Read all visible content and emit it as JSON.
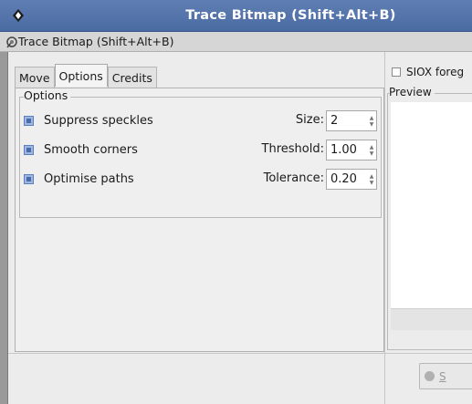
{
  "window": {
    "title": "Trace Bitmap (Shift+Alt+B)"
  },
  "dock": {
    "tab_title": "Trace Bitmap (Shift+Alt+B)"
  },
  "tabs": [
    {
      "label": "Move"
    },
    {
      "label": "Options"
    },
    {
      "label": "Credits"
    }
  ],
  "options": {
    "frame_label": "Options",
    "rows": [
      {
        "label": "Suppress speckles",
        "field_label": "Size:",
        "value": "2"
      },
      {
        "label": "Smooth corners",
        "field_label": "Threshold:",
        "value": "1.00"
      },
      {
        "label": "Optimise paths",
        "field_label": "Tolerance:",
        "value": "0.20"
      }
    ]
  },
  "right": {
    "siox_label": "SIOX foreg",
    "preview_label": "Preview"
  },
  "buttons": {
    "stop_label": "S"
  },
  "icons": {
    "window": "inkscape-logo-icon",
    "dock": "trace-bitmap-icon",
    "stop": "stop-icon"
  }
}
